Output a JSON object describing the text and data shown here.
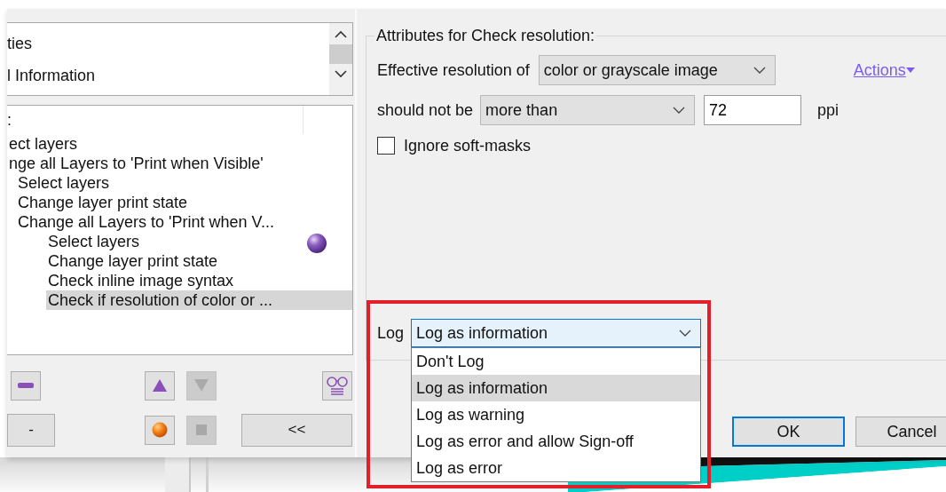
{
  "top_list": {
    "items": [
      {
        "label": "ties",
        "selected": false
      },
      {
        "label": "l Information",
        "selected": false
      }
    ]
  },
  "tree": {
    "header": ":",
    "items": [
      {
        "label": "ect layers",
        "selected": false
      },
      {
        "label": "nge all Layers to 'Print when Visible'",
        "selected": false,
        "children": [
          {
            "label": "Select layers",
            "selected": false
          },
          {
            "label": "Change layer print state",
            "selected": false
          },
          {
            "label": "Change all Layers to 'Print when V...",
            "selected": false,
            "children": [
              {
                "label": "Select layers",
                "selected": false
              },
              {
                "label": "Change layer print state",
                "selected": false
              },
              {
                "label": "Check inline image syntax",
                "selected": false
              },
              {
                "label": "Check if resolution of color or ...",
                "selected": true
              }
            ]
          }
        ]
      }
    ]
  },
  "toolbar_rows": [
    [
      {
        "kind": "remove",
        "disabled": false
      },
      {
        "kind": "up",
        "disabled": false
      },
      {
        "kind": "down",
        "disabled": true
      },
      {
        "kind": "glasses",
        "disabled": false
      }
    ],
    [
      {
        "kind": "text",
        "label": "-",
        "disabled": false
      },
      {
        "kind": "record",
        "disabled": false
      },
      {
        "kind": "stop",
        "disabled": true
      },
      {
        "kind": "text",
        "label": "<<",
        "disabled": false
      }
    ]
  ],
  "attributes": {
    "title": "Attributes for Check resolution:",
    "resolution_label": "Effective resolution of",
    "resolution_select": "color or grayscale image",
    "actions_link": "Actions",
    "limit_label": "should not be",
    "limit_select": "more than",
    "limit_value": "72",
    "unit": "ppi",
    "ignore_soft_masks": {
      "label": "Ignore soft-masks",
      "checked": false
    }
  },
  "log": {
    "label": "Log",
    "value": "Log as information",
    "expanded": true,
    "options": [
      {
        "label": "Don't Log",
        "selected": false
      },
      {
        "label": "Log as information",
        "selected": true
      },
      {
        "label": "Log as warning",
        "selected": false
      },
      {
        "label": "Log as error and allow Sign-off",
        "selected": false
      },
      {
        "label": "Log as error",
        "selected": false
      }
    ]
  },
  "buttons": [
    {
      "label": "OK",
      "default": true
    },
    {
      "label": "Cancel",
      "default": false
    }
  ]
}
